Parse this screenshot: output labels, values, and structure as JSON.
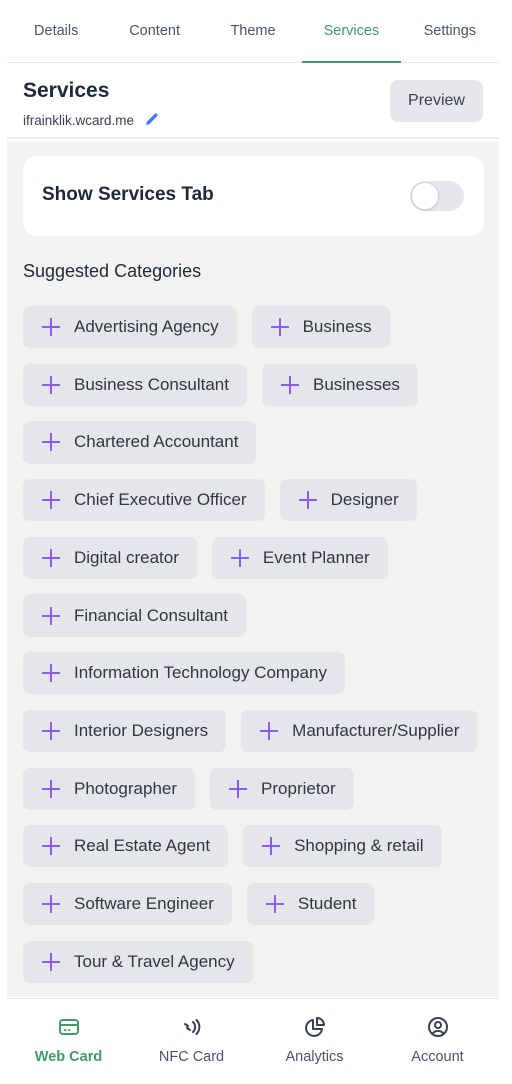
{
  "tabs": [
    {
      "label": "Details",
      "active": false
    },
    {
      "label": "Content",
      "active": false
    },
    {
      "label": "Theme",
      "active": false
    },
    {
      "label": "Services",
      "active": true
    },
    {
      "label": "Settings",
      "active": false
    }
  ],
  "header": {
    "title": "Services",
    "url": "ifrainklik.wcard.me",
    "edit_icon": "pencil-icon",
    "preview_label": "Preview"
  },
  "toggle_card": {
    "label": "Show Services Tab",
    "enabled": false
  },
  "suggested": {
    "title": "Suggested Categories",
    "icon": "plus-icon",
    "items": [
      "Advertising Agency",
      "Business",
      "Business Consultant",
      "Businesses",
      "Chartered Accountant",
      "Chief Executive Officer",
      "Designer",
      "Digital creator",
      "Event Planner",
      "Financial Consultant",
      "Information Technology Company",
      "Interior Designers",
      "Manufacturer/Supplier",
      "Photographer",
      "Proprietor",
      "Real Estate Agent",
      "Shopping & retail",
      "Software Engineer",
      "Student",
      "Tour & Travel Agency"
    ]
  },
  "bottom_nav": [
    {
      "label": "Web Card",
      "icon": "card-icon",
      "active": true
    },
    {
      "label": "NFC Card",
      "icon": "nfc-icon",
      "active": false
    },
    {
      "label": "Analytics",
      "icon": "pie-chart-icon",
      "active": false
    },
    {
      "label": "Account",
      "icon": "user-circle-icon",
      "active": false
    }
  ],
  "colors": {
    "accent": "#3f9a6c",
    "plus": "#8b5cf6",
    "edit": "#3b82f6",
    "chip_bg": "#e5e6ea",
    "page_bg": "#f2f2f1"
  }
}
